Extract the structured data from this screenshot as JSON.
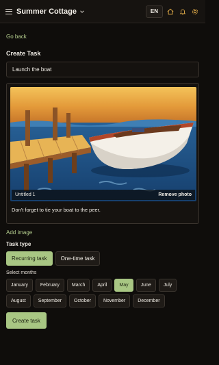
{
  "header": {
    "title": "Summer Cottage",
    "lang": "EN",
    "icons": [
      "menu-icon",
      "chevron-down-icon",
      "home-icon",
      "bell-icon",
      "gear-icon"
    ]
  },
  "nav": {
    "go_back": "Go back"
  },
  "form": {
    "title": "Create Task",
    "task_name_value": "Launch the boat",
    "photo": {
      "name": "Untitled 1",
      "remove_label": "Remove photo",
      "caption": "Don't forget to tie your boat to the peer."
    },
    "add_image": "Add image",
    "task_type_label": "Task type",
    "task_types": [
      {
        "label": "Recurring task",
        "active": true
      },
      {
        "label": "One-time task",
        "active": false
      }
    ],
    "select_months_label": "Select months",
    "months": [
      {
        "label": "January",
        "active": false
      },
      {
        "label": "February",
        "active": false
      },
      {
        "label": "March",
        "active": false
      },
      {
        "label": "April",
        "active": false
      },
      {
        "label": "May",
        "active": true
      },
      {
        "label": "June",
        "active": false
      },
      {
        "label": "July",
        "active": false
      },
      {
        "label": "August",
        "active": false
      },
      {
        "label": "September",
        "active": false
      },
      {
        "label": "October",
        "active": false
      },
      {
        "label": "November",
        "active": false
      },
      {
        "label": "December",
        "active": false
      }
    ],
    "create_label": "Create task"
  },
  "colors": {
    "background": "#0f0d0b",
    "accent": "#a8c683",
    "link": "#b6cf8f",
    "border": "#3a342e"
  }
}
